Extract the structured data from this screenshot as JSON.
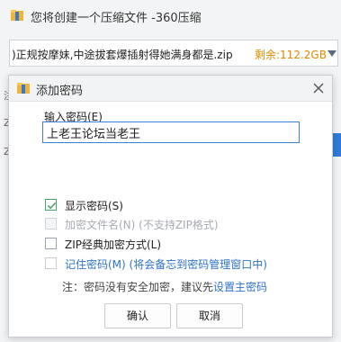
{
  "background_window": {
    "title": "您将创建一个压缩文件 -360压缩",
    "archive_path": ")正规按摩妹,中途拔套爆插射得她满身都是.zip",
    "free_space": "剩余:112.2GB",
    "edge_letters": [
      "注",
      "Z",
      "Z"
    ],
    "side_button_label": "立"
  },
  "dialog": {
    "title": "添加密码",
    "password_label": "输入密码(E)",
    "password_value": "上老王论坛当老王",
    "options": [
      {
        "label": "显示密码(S)",
        "checked": true,
        "enabled": true
      },
      {
        "label": "加密文件名(N) (不支持ZIP格式)",
        "checked": false,
        "enabled": false
      },
      {
        "label": "ZIP经典加密方式(L)",
        "checked": false,
        "enabled": true
      },
      {
        "label": "记住密码(M) (将会备忘到密码管理窗口中)",
        "checked": false,
        "enabled": true
      }
    ],
    "note_prefix": "注：密码没有安全加密，建议先",
    "note_link": "设置主密码",
    "ok_label": "确认",
    "cancel_label": "取消"
  },
  "colors": {
    "accent": "#2d73c9",
    "check": "#49a36a",
    "free_space": "#e08a00"
  },
  "icons": {
    "app": "archive-folder-icon",
    "close": "close-icon",
    "dropdown": "chevron-down-icon"
  }
}
